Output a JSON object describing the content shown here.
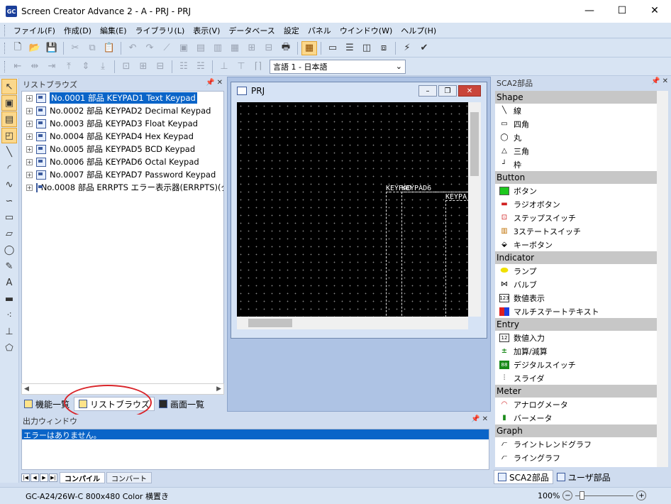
{
  "window": {
    "title": "Screen Creator Advance 2 - A - PRJ - PRJ",
    "app_icon": "GC",
    "minimize": "—",
    "maximize": "☐",
    "close": "✕"
  },
  "menu": [
    "ファイル(F)",
    "作成(D)",
    "編集(E)",
    "ライブラリ(L)",
    "表示(V)",
    "データベース",
    "設定",
    "パネル",
    "ウインドウ(W)",
    "ヘルプ(H)"
  ],
  "toolbar": {
    "language_select": "言語 1 - 日本語"
  },
  "list_browser": {
    "title": "リストブラウズ",
    "items": [
      {
        "label": "No.0001 部品 KEYPAD1  Text Keypad"
      },
      {
        "label": "No.0002 部品 KEYPAD2  Decimal Keypad"
      },
      {
        "label": "No.0003 部品 KEYPAD3  Float Keypad"
      },
      {
        "label": "No.0004 部品 KEYPAD4  Hex Keypad"
      },
      {
        "label": "No.0005 部品 KEYPAD5  BCD Keypad"
      },
      {
        "label": "No.0006 部品 KEYPAD6  Octal Keypad"
      },
      {
        "label": "No.0007 部品 KEYPAD7  Password Keypad"
      },
      {
        "label": "No.0008 部品 ERRPTS  エラー表示器(ERRPTS)(グ"
      }
    ],
    "tabs": [
      "機能一覧",
      "リストブラウズ",
      "画面一覧"
    ]
  },
  "editor": {
    "title": "PRJ",
    "canvas_labels": [
      "KEYPAD6",
      "KEYPAD",
      "KEYPA"
    ]
  },
  "parts": {
    "title": "SCA2部品",
    "categories": [
      {
        "name": "Shape",
        "items": [
          {
            "label": "線",
            "icon": "line-icon"
          },
          {
            "label": "四角",
            "icon": "rect-icon"
          },
          {
            "label": "丸",
            "icon": "circle-icon"
          },
          {
            "label": "三角",
            "icon": "triangle-icon"
          },
          {
            "label": "枠",
            "icon": "frame-icon"
          }
        ]
      },
      {
        "name": "Button",
        "items": [
          {
            "label": "ボタン",
            "icon": "button-icon"
          },
          {
            "label": "ラジオボタン",
            "icon": "radio-button-icon"
          },
          {
            "label": "ステップスイッチ",
            "icon": "step-switch-icon"
          },
          {
            "label": "3ステートスイッチ",
            "icon": "three-state-switch-icon"
          },
          {
            "label": "キーボタン",
            "icon": "key-button-icon"
          }
        ]
      },
      {
        "name": "Indicator",
        "items": [
          {
            "label": "ランプ",
            "icon": "lamp-icon"
          },
          {
            "label": "バルブ",
            "icon": "valve-icon"
          },
          {
            "label": "数値表示",
            "icon": "numeric-display-icon"
          },
          {
            "label": "マルチステートテキスト",
            "icon": "multistate-text-icon"
          }
        ]
      },
      {
        "name": "Entry",
        "items": [
          {
            "label": "数値入力",
            "icon": "numeric-input-icon"
          },
          {
            "label": "加算/減算",
            "icon": "add-subtract-icon"
          },
          {
            "label": "デジタルスイッチ",
            "icon": "digital-switch-icon"
          },
          {
            "label": "スライダ",
            "icon": "slider-icon"
          }
        ]
      },
      {
        "name": "Meter",
        "items": [
          {
            "label": "アナログメータ",
            "icon": "analog-meter-icon"
          },
          {
            "label": "バーメータ",
            "icon": "bar-meter-icon"
          }
        ]
      },
      {
        "name": "Graph",
        "items": [
          {
            "label": "ライントレンドグラフ",
            "icon": "line-trend-graph-icon"
          },
          {
            "label": "ライングラフ",
            "icon": "line-graph-icon"
          }
        ]
      }
    ],
    "tabs": [
      "SCA2部品",
      "ユーザ部品"
    ]
  },
  "output": {
    "title": "出力ウィンドウ",
    "message": "エラーはありません。",
    "tabs": [
      "コンパイル",
      "コンバート"
    ]
  },
  "status": {
    "text": "GC-A24/26W-C 800x480 Color 横置き",
    "zoom": "100%"
  }
}
